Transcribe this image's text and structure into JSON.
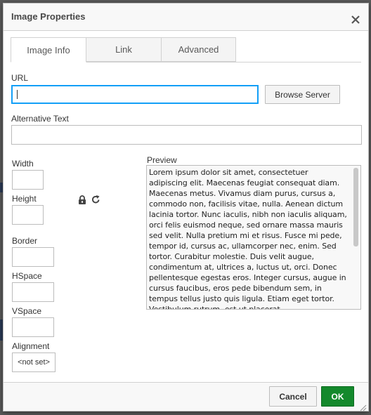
{
  "dialog": {
    "title": "Image Properties",
    "close_icon": "close-icon"
  },
  "tabs": [
    {
      "label": "Image Info",
      "active": true
    },
    {
      "label": "Link",
      "active": false
    },
    {
      "label": "Advanced",
      "active": false
    }
  ],
  "fields": {
    "url_label": "URL",
    "url_value": "",
    "browse_label": "Browse Server",
    "alt_label": "Alternative Text",
    "alt_value": "",
    "width_label": "Width",
    "height_label": "Height",
    "border_label": "Border",
    "hspace_label": "HSpace",
    "vspace_label": "VSpace",
    "alignment_label": "Alignment",
    "alignment_value": "<not set>",
    "lock_icon": "lock-icon",
    "reset_icon": "reset-size-icon"
  },
  "preview": {
    "label": "Preview",
    "text": "Lorem ipsum dolor sit amet, consectetuer adipiscing elit. Maecenas feugiat consequat diam. Maecenas metus. Vivamus diam purus, cursus a, commodo non, facilisis vitae, nulla. Aenean dictum lacinia tortor. Nunc iaculis, nibh non iaculis aliquam, orci felis euismod neque, sed ornare massa mauris sed velit. Nulla pretium mi et risus. Fusce mi pede, tempor id, cursus ac, ullamcorper nec, enim. Sed tortor. Curabitur molestie. Duis velit augue, condimentum at, ultrices a, luctus ut, orci. Donec pellentesque egestas eros. Integer cursus, augue in cursus faucibus, eros pede bibendum sem, in tempus tellus justo quis ligula. Etiam eget tortor. Vestibulum rutrum, est ut placerat"
  },
  "footer": {
    "cancel_label": "Cancel",
    "ok_label": "OK"
  },
  "colors": {
    "accent_focus": "#139ff7",
    "ok_green": "#14892c"
  }
}
